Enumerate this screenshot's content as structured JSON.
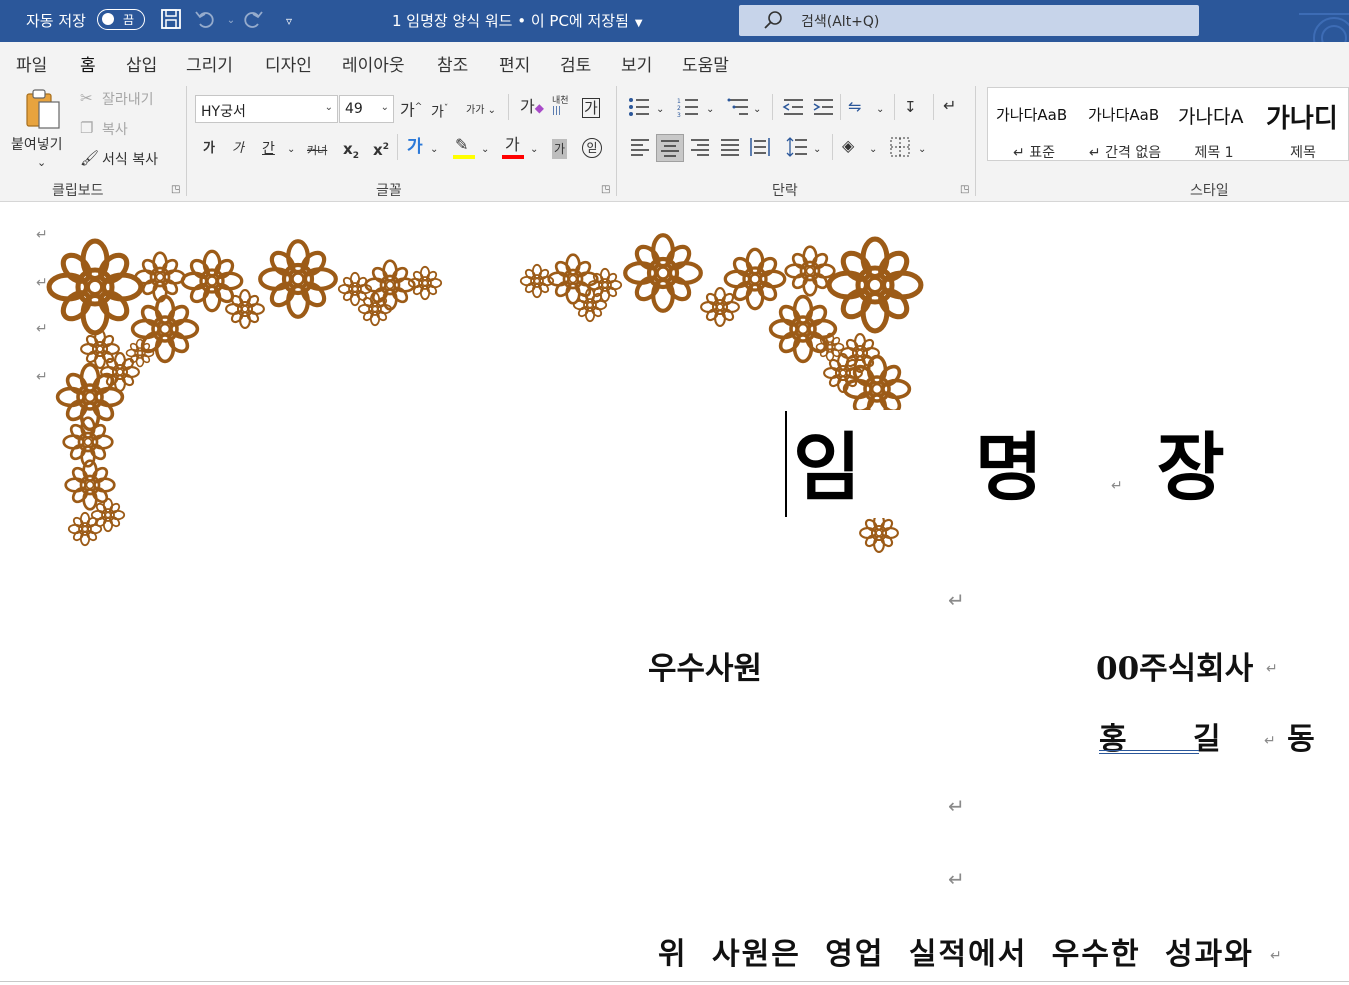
{
  "titlebar": {
    "autosave_label": "자동 저장",
    "autosave_state": "끔",
    "document_title": "1 임명장 양식 워드 • 이 PC에 저장됨",
    "search_placeholder": "검색(Alt+Q)"
  },
  "tabs": [
    "파일",
    "홈",
    "삽입",
    "그리기",
    "디자인",
    "레이아웃",
    "참조",
    "편지",
    "검토",
    "보기",
    "도움말"
  ],
  "active_tab": "홈",
  "clipboard": {
    "paste_label": "붙여넣기",
    "cut_label": "잘라내기",
    "copy_label": "복사",
    "format_painter_label": "서식 복사",
    "group_label": "클립보드"
  },
  "font": {
    "font_name": "HY궁서",
    "font_size": "49",
    "group_label": "글꼴",
    "grow_glyph": "가",
    "shrink_glyph": "가",
    "change_case_glyph": "가가",
    "clear_format_glyph": "가",
    "phonetic_glyph": "내천",
    "char_border_glyph": "가",
    "bold_glyph": "가",
    "italic_glyph": "가",
    "underline_glyph": "간",
    "strike_glyph": "커녀",
    "sub_glyph": "x",
    "sup_glyph": "x",
    "effects_glyph": "가",
    "highlight_color": "#ffff00",
    "font_color_glyph": "가",
    "font_color": "#ff0000",
    "shading_glyph": "가",
    "enclose_glyph": "읻"
  },
  "paragraph": {
    "group_label": "단락"
  },
  "styles": {
    "group_label": "스타일",
    "items": [
      {
        "preview": "가나다AaB",
        "name": "↵ 표준"
      },
      {
        "preview": "가나다AaB",
        "name": "↵ 간격 없음"
      },
      {
        "preview": "가나다A",
        "name": "제목 1"
      },
      {
        "preview": "가나디",
        "name": "제목"
      }
    ]
  },
  "document": {
    "title": "임 명 장",
    "position": "우수사원",
    "company": "00주식회사",
    "person_name": "홍 길 동",
    "body_line": "위 사원은 영업 실적에서 우수한 성과와",
    "paragraph_mark": "↵",
    "ornament_color": "#9c5b17"
  },
  "colors": {
    "word_blue": "#2b579a",
    "ribbon_bg": "#f3f3f3",
    "search_bg": "#c7d4ea"
  }
}
